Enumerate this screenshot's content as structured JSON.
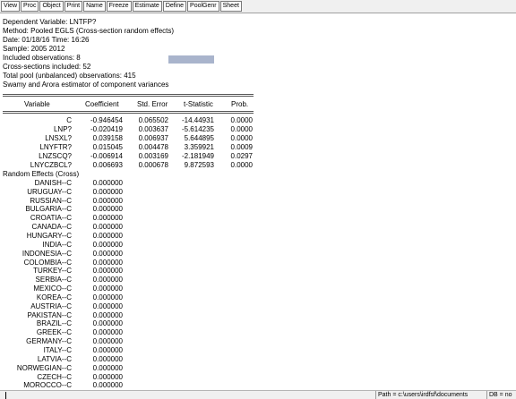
{
  "toolbar": {
    "buttons": [
      "View",
      "Proc",
      "Object",
      "Print",
      "Name",
      "Freeze",
      "Estimate",
      "Define",
      "PoolGenr",
      "Sheet"
    ]
  },
  "header": {
    "lines": [
      "Dependent Variable: LNTFP?",
      "Method: Pooled EGLS (Cross-section random effects)",
      "Date: 01/18/16   Time: 16:26",
      "Sample: 2005 2012",
      "Included observations: 8",
      "Cross-sections included: 52",
      "Total pool (unbalanced) observations: 415",
      "Swamy and Arora estimator of component variances"
    ]
  },
  "table": {
    "columns": [
      "Variable",
      "Coefficient",
      "Std. Error",
      "t-Statistic",
      "Prob."
    ],
    "rows": [
      {
        "name": "C",
        "coef": "-0.946454",
        "se": "0.065502",
        "t": "-14.44931",
        "p": "0.0000"
      },
      {
        "name": "LNP?",
        "coef": "-0.020419",
        "se": "0.003637",
        "t": "-5.614235",
        "p": "0.0000"
      },
      {
        "name": "LNSXL?",
        "coef": "0.039158",
        "se": "0.006937",
        "t": "5.644895",
        "p": "0.0000"
      },
      {
        "name": "LNYFTR?",
        "coef": "0.015045",
        "se": "0.004478",
        "t": "3.359921",
        "p": "0.0009"
      },
      {
        "name": "LNZSCQ?",
        "coef": "-0.006914",
        "se": "0.003169",
        "t": "-2.181949",
        "p": "0.0297"
      },
      {
        "name": "LNYCZBCL?",
        "coef": "0.006693",
        "se": "0.000678",
        "t": "9.872593",
        "p": "0.0000"
      }
    ]
  },
  "random_effects": {
    "title": "Random Effects (Cross)",
    "rows": [
      {
        "name": "DANISH--C",
        "value": "0.000000"
      },
      {
        "name": "URUGUAY--C",
        "value": "0.000000"
      },
      {
        "name": "RUSSIAN--C",
        "value": "0.000000"
      },
      {
        "name": "BULGARIA--C",
        "value": "0.000000"
      },
      {
        "name": "CROATIA--C",
        "value": "0.000000"
      },
      {
        "name": "CANADA--C",
        "value": "0.000000"
      },
      {
        "name": "HUNGARY--C",
        "value": "0.000000"
      },
      {
        "name": "INDIA--C",
        "value": "0.000000"
      },
      {
        "name": "INDONESIA--C",
        "value": "0.000000"
      },
      {
        "name": "COLOMBIA--C",
        "value": "0.000000"
      },
      {
        "name": "TURKEY--C",
        "value": "0.000000"
      },
      {
        "name": "SERBIA--C",
        "value": "0.000000"
      },
      {
        "name": "MEXICO--C",
        "value": "0.000000"
      },
      {
        "name": "KOREA--C",
        "value": "0.000000"
      },
      {
        "name": "AUSTRIA--C",
        "value": "0.000000"
      },
      {
        "name": "PAKISTAN--C",
        "value": "0.000000"
      },
      {
        "name": "BRAZIL--C",
        "value": "0.000000"
      },
      {
        "name": "GREEK--C",
        "value": "0.000000"
      },
      {
        "name": "GERMANY--C",
        "value": "0.000000"
      },
      {
        "name": "ITALY--C",
        "value": "0.000000"
      },
      {
        "name": "LATVIA--C",
        "value": "0.000000"
      },
      {
        "name": "NORWEGIAN--C",
        "value": "0.000000"
      },
      {
        "name": "CZECH--C",
        "value": "0.000000"
      },
      {
        "name": "MOROCCO--C",
        "value": "0.000000"
      }
    ]
  },
  "status": {
    "path": "Path = c:\\users\\irdfsf\\documents",
    "db": "DB = no"
  },
  "colors": {
    "selection": "#a9b4cc",
    "toolbar_bg": "#f0f0f0"
  }
}
